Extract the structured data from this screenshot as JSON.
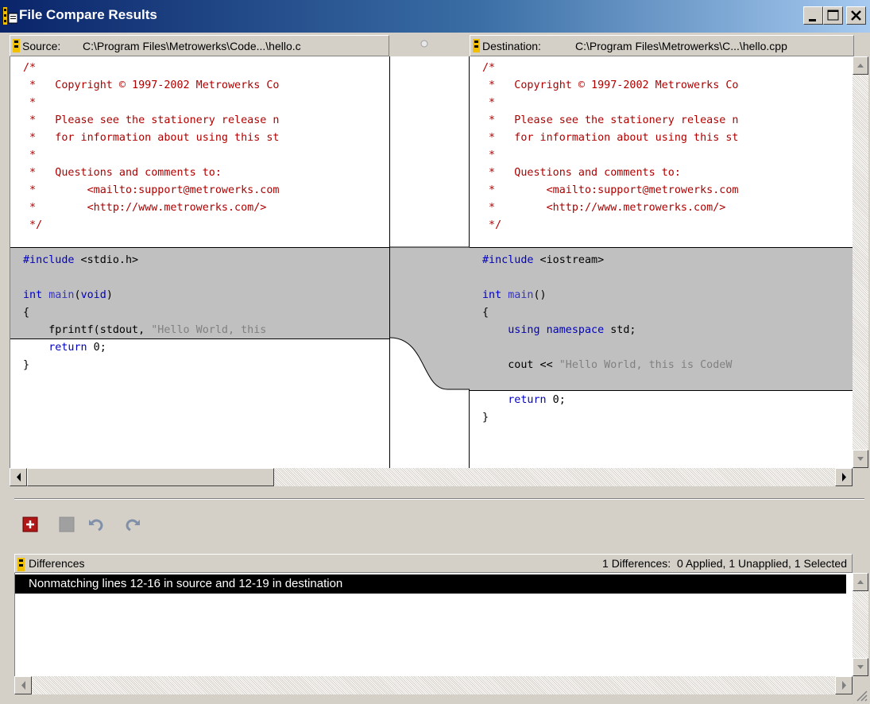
{
  "window": {
    "title": "File Compare Results"
  },
  "source": {
    "label": "Source:",
    "path": "C:\\Program Files\\Metrowerks\\Code...\\hello.c",
    "lines": [
      [
        [
          "c",
          "/*"
        ]
      ],
      [
        [
          "c",
          " *   Copyright © 1997-2002 Metrowerks Co"
        ]
      ],
      [
        [
          "c",
          " *"
        ]
      ],
      [
        [
          "c",
          " *   Please see the stationery release n"
        ]
      ],
      [
        [
          "c",
          " *   for information about using this st"
        ]
      ],
      [
        [
          "c",
          " *"
        ]
      ],
      [
        [
          "c",
          " *   Questions and comments to:"
        ]
      ],
      [
        [
          "c",
          " *        <mailto:support@metrowerks.com"
        ]
      ],
      [
        [
          "c",
          " *        <http://www.metrowerks.com/>"
        ]
      ],
      [
        [
          "c",
          " */"
        ]
      ],
      [],
      [
        [
          "k",
          "#include"
        ],
        [
          "p",
          " <stdio.h>"
        ]
      ],
      [],
      [
        [
          "k",
          "int "
        ],
        [
          "f",
          "main"
        ],
        [
          "p",
          "("
        ],
        [
          "k",
          "void"
        ],
        [
          "p",
          ")"
        ]
      ],
      [
        [
          "p",
          "{"
        ]
      ],
      [
        [
          "p",
          "    fprintf(stdout, "
        ],
        [
          "s",
          "\"Hello World, this"
        ]
      ],
      [
        [
          "p",
          "    "
        ],
        [
          "k",
          "return"
        ],
        [
          "p",
          " 0;"
        ]
      ],
      [
        [
          "p",
          "}"
        ]
      ]
    ]
  },
  "destination": {
    "label": "Destination:",
    "path": "C:\\Program Files\\Metrowerks\\C...\\hello.cpp",
    "lines": [
      [
        [
          "c",
          "/*"
        ]
      ],
      [
        [
          "c",
          " *   Copyright © 1997-2002 Metrowerks Co"
        ]
      ],
      [
        [
          "c",
          " *"
        ]
      ],
      [
        [
          "c",
          " *   Please see the stationery release n"
        ]
      ],
      [
        [
          "c",
          " *   for information about using this st"
        ]
      ],
      [
        [
          "c",
          " *"
        ]
      ],
      [
        [
          "c",
          " *   Questions and comments to:"
        ]
      ],
      [
        [
          "c",
          " *        <mailto:support@metrowerks.com"
        ]
      ],
      [
        [
          "c",
          " *        <http://www.metrowerks.com/>"
        ]
      ],
      [
        [
          "c",
          " */"
        ]
      ],
      [],
      [
        [
          "k",
          "#include"
        ],
        [
          "p",
          " <iostream>"
        ]
      ],
      [],
      [
        [
          "k",
          "int "
        ],
        [
          "f",
          "main"
        ],
        [
          "p",
          "()"
        ]
      ],
      [
        [
          "p",
          "{"
        ]
      ],
      [
        [
          "p",
          "    "
        ],
        [
          "k",
          "using namespace"
        ],
        [
          "p",
          " std;"
        ]
      ],
      [],
      [
        [
          "p",
          "    cout << "
        ],
        [
          "s",
          "\"Hello World, this is CodeW"
        ]
      ],
      [],
      [
        [
          "p",
          "    "
        ],
        [
          "k",
          "return"
        ],
        [
          "p",
          " 0;"
        ]
      ],
      [
        [
          "p",
          "}"
        ]
      ]
    ]
  },
  "differences": {
    "title": "Differences",
    "summary": "1 Differences:  0 Applied, 1 Unapplied, 1 Selected",
    "items": [
      "Nonmatching lines 12-16 in source and 12-19 in destination"
    ]
  },
  "toolbar": {
    "icons": [
      "apply-icon",
      "unapply-icon",
      "undo-icon",
      "redo-icon"
    ]
  },
  "colors": {
    "comment": "#b00000",
    "keyword": "#0000c0",
    "string": "#808080",
    "diff_band": "#c0c0c0",
    "titlebar": "#0a246a"
  }
}
